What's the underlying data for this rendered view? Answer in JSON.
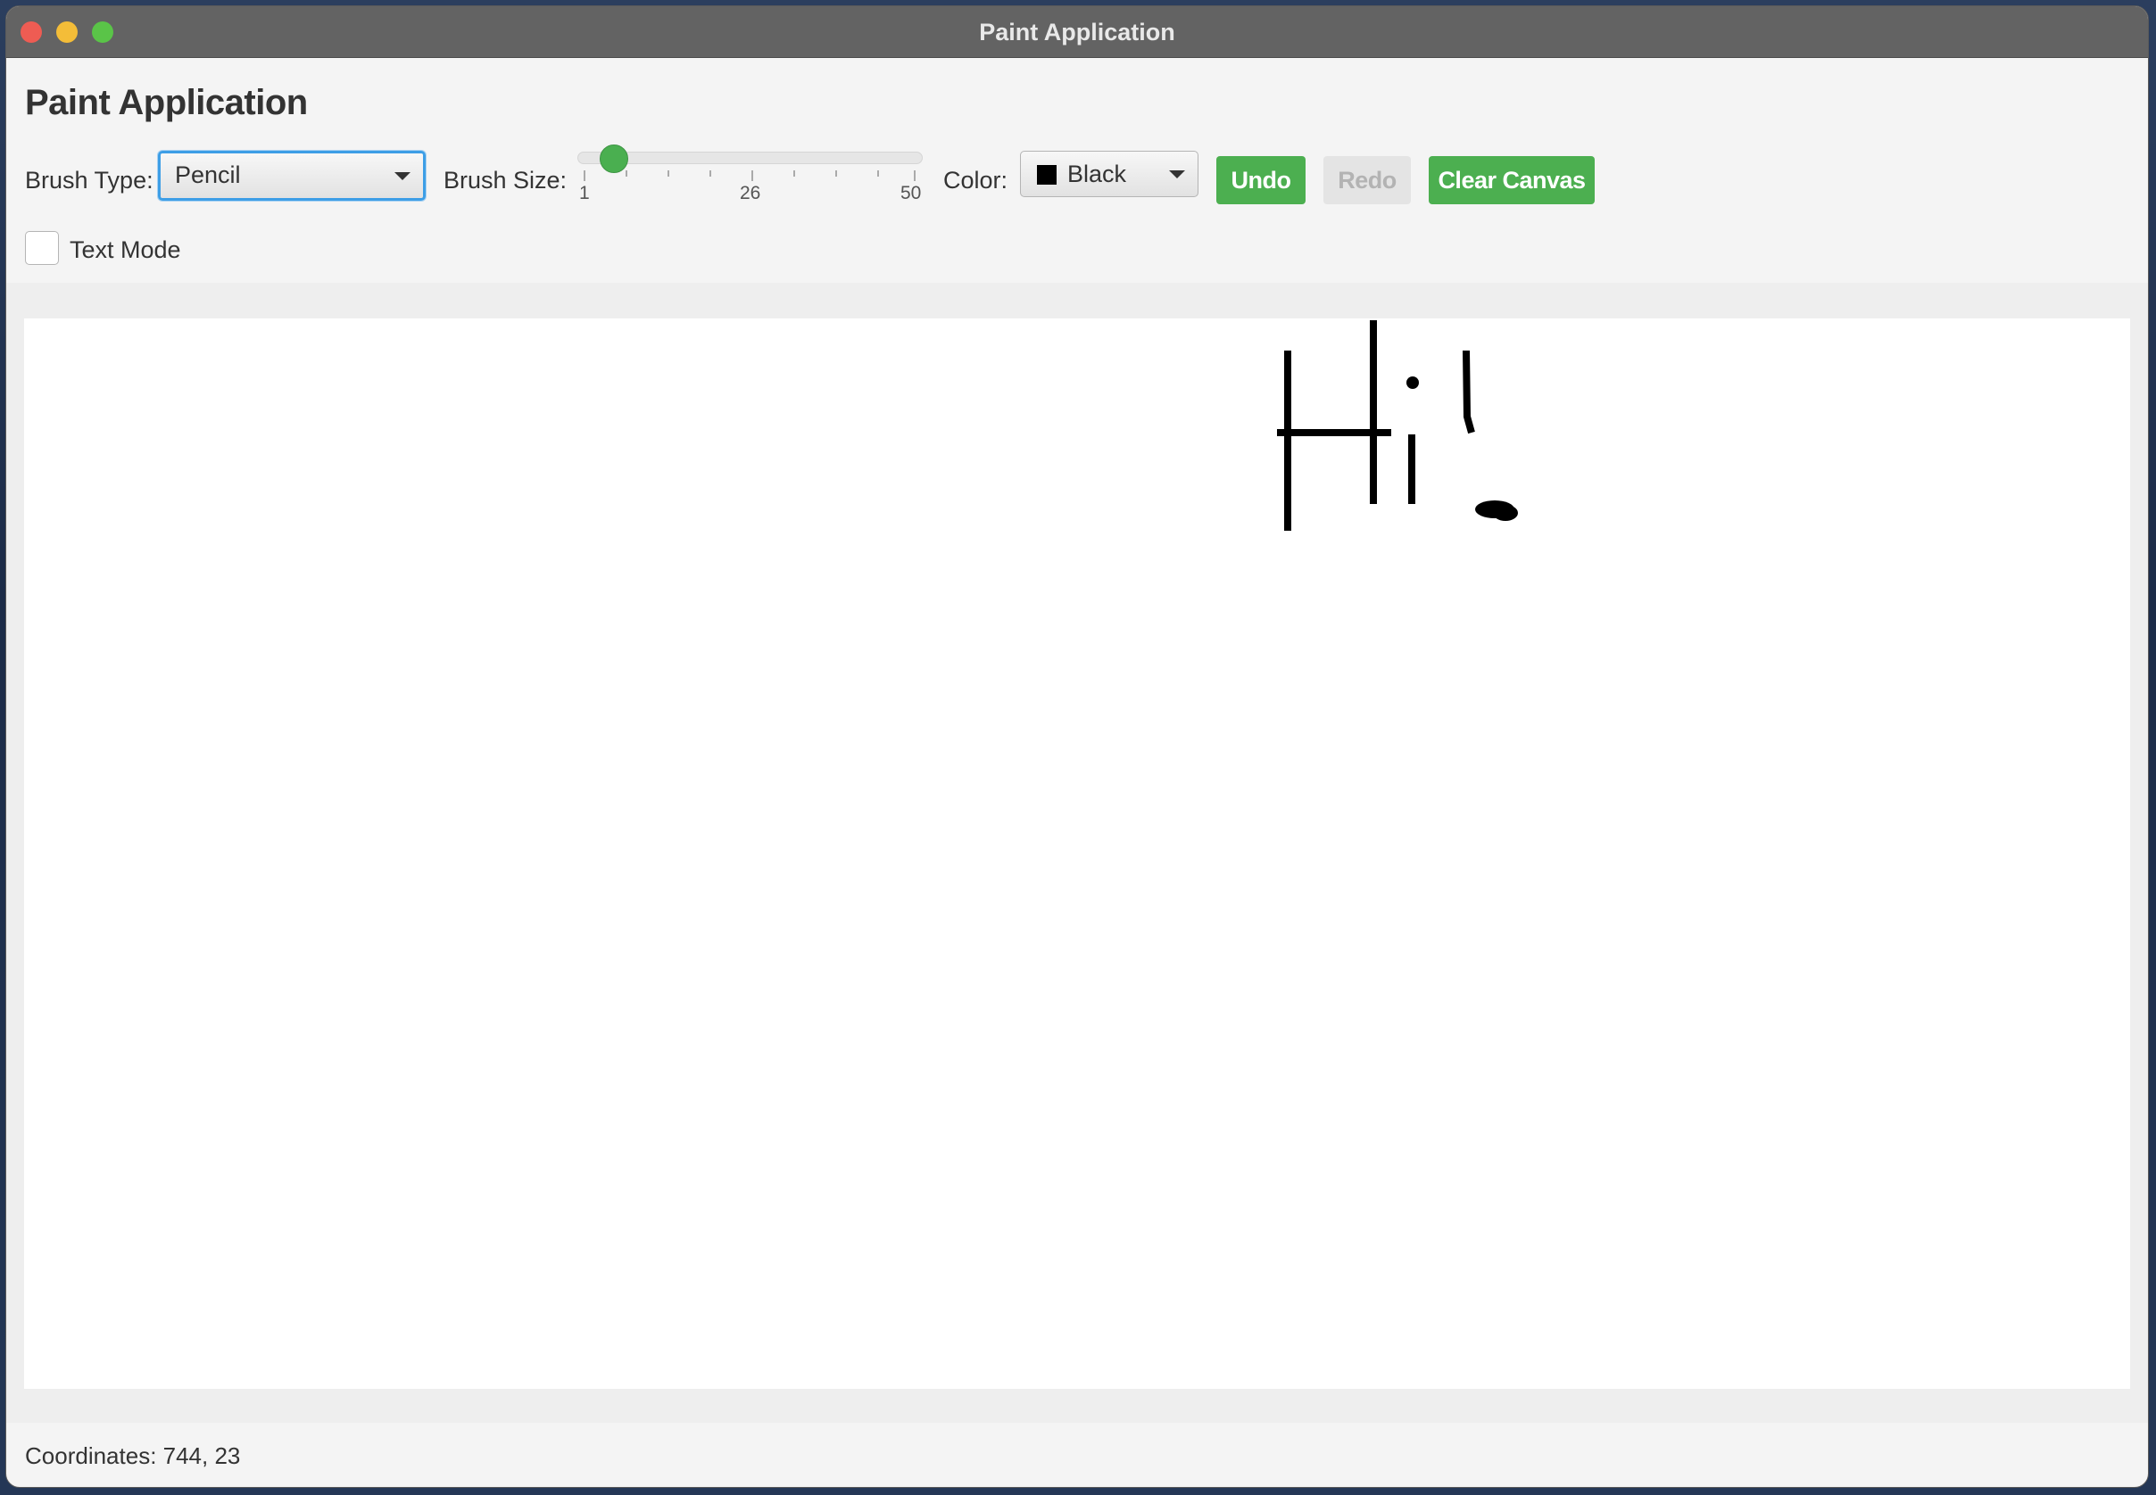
{
  "window": {
    "title": "Paint Application"
  },
  "header": {
    "title": "Paint Application"
  },
  "toolbar": {
    "brush_type_label": "Brush Type:",
    "brush_type_value": "Pencil",
    "brush_size_label": "Brush Size:",
    "brush_size": {
      "min": 1,
      "max": 50,
      "value": 4,
      "tick_labels": [
        "1",
        "26",
        "50"
      ]
    },
    "color_label": "Color:",
    "color_value": "Black",
    "color_hex": "#000000",
    "undo_label": "Undo",
    "redo_label": "Redo",
    "clear_label": "Clear Canvas",
    "text_mode_label": "Text Mode",
    "text_mode_checked": false
  },
  "colors": {
    "accent": "#4caf50",
    "focus": "#3d9ee6"
  },
  "canvas": {
    "drawing": "Hi!"
  },
  "status": {
    "coordinates": "Coordinates: 744, 23"
  }
}
